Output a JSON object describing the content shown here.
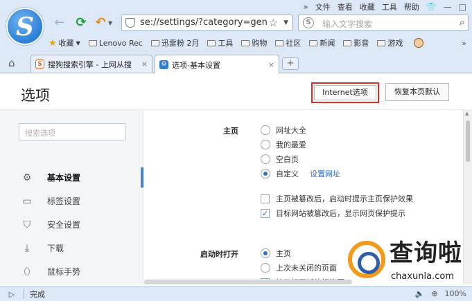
{
  "menubar": {
    "items": [
      "文件",
      "查看",
      "收藏",
      "工具",
      "帮助"
    ],
    "more": "»",
    "shirt": "👕",
    "minimize": "—",
    "maximize": "□"
  },
  "nav": {
    "back": "←",
    "forward": "→",
    "refresh": "⟳",
    "undo": "↶"
  },
  "address": {
    "url": "se://settings/?category=gen"
  },
  "search": {
    "placeholder": "输入文字搜索",
    "engine_glyph": "S"
  },
  "favbar": {
    "favorites_label": "收藏",
    "folders": [
      "Lenovo Rec",
      "迅雷粉 2月",
      "工具",
      "购物",
      "社区",
      "新闻",
      "影音",
      "游戏"
    ],
    "more": "»"
  },
  "tabs": [
    {
      "label": "搜狗搜索引擎 - 上网从搜",
      "icon": "S",
      "close": "×"
    },
    {
      "label": "选项-基本设置",
      "icon": "⚙",
      "close": "×"
    }
  ],
  "new_tab": "+",
  "page": {
    "title": "选项",
    "internet_options": "Internet选项",
    "restore_defaults": "恢复本页默认",
    "sidebar_search_placeholder": "搜索选项",
    "sidebar_items": [
      {
        "label": "基本设置",
        "icon": "gear-icon",
        "glyph": "⚙",
        "active": true
      },
      {
        "label": "标签设置",
        "icon": "tab-icon",
        "glyph": "▭",
        "active": false
      },
      {
        "label": "安全设置",
        "icon": "shield-icon",
        "glyph": "⛉",
        "active": false
      },
      {
        "label": "下载",
        "icon": "download-icon",
        "glyph": "⤓",
        "active": false
      },
      {
        "label": "鼠标手势",
        "icon": "mouse-icon",
        "glyph": "⬯",
        "active": false
      }
    ],
    "homepage": {
      "label": "主页",
      "options": [
        {
          "label": "网址大全",
          "selected": false
        },
        {
          "label": "我的最爱",
          "selected": false
        },
        {
          "label": "空白页",
          "selected": false
        },
        {
          "label": "自定义",
          "selected": true
        }
      ],
      "set_url_link": "设置网址",
      "checkboxes": [
        {
          "label": "主页被篡改后，启动时提示主页保护效果",
          "checked": false
        },
        {
          "label": "目标网站被篡改后，显示网页保护提示",
          "checked": true
        }
      ]
    },
    "startup": {
      "label": "启动时打开",
      "options": [
        {
          "label": "主页",
          "selected": true
        },
        {
          "label": "上次未关闭的页面",
          "selected": false
        }
      ],
      "partial_checkbox": {
        "label": "始终打开新的标签页",
        "checked": true
      }
    }
  },
  "watermark": {
    "title": "查询啦",
    "url": "chaxunla.com"
  },
  "status": {
    "toggle": "▷",
    "text": "完成",
    "zoom": "100%"
  },
  "colors": {
    "accent": "#2f6fcf",
    "highlight_border": "#d0312d",
    "chrome_bg": "#dde8f6"
  }
}
